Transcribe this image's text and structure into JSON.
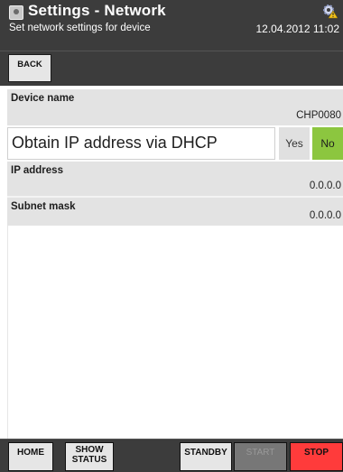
{
  "header": {
    "title": "Settings - Network",
    "subtitle": "Set network settings for device",
    "datetime": "12.04.2012 11:02"
  },
  "toolbar": {
    "back_label": "BACK"
  },
  "device": {
    "label": "Device name",
    "value": "CHP0080"
  },
  "dhcp": {
    "label": "Obtain IP address via DHCP",
    "yes_label": "Yes",
    "no_label": "No",
    "selected": "No"
  },
  "ip": {
    "label": "IP address",
    "value": "0.0.0.0"
  },
  "subnet": {
    "label": "Subnet mask",
    "value": "0.0.0.0"
  },
  "footer": {
    "home_label": "HOME",
    "show_label_line1": "SHOW",
    "show_label_line2": "STATUS",
    "standby_label": "STANDBY",
    "start_label": "START",
    "stop_label": "STOP"
  },
  "colors": {
    "header_bg": "#3c3c3c",
    "selected_option": "#8cc63f",
    "stop": "#ff3b3b",
    "start_disabled": "#777777"
  }
}
